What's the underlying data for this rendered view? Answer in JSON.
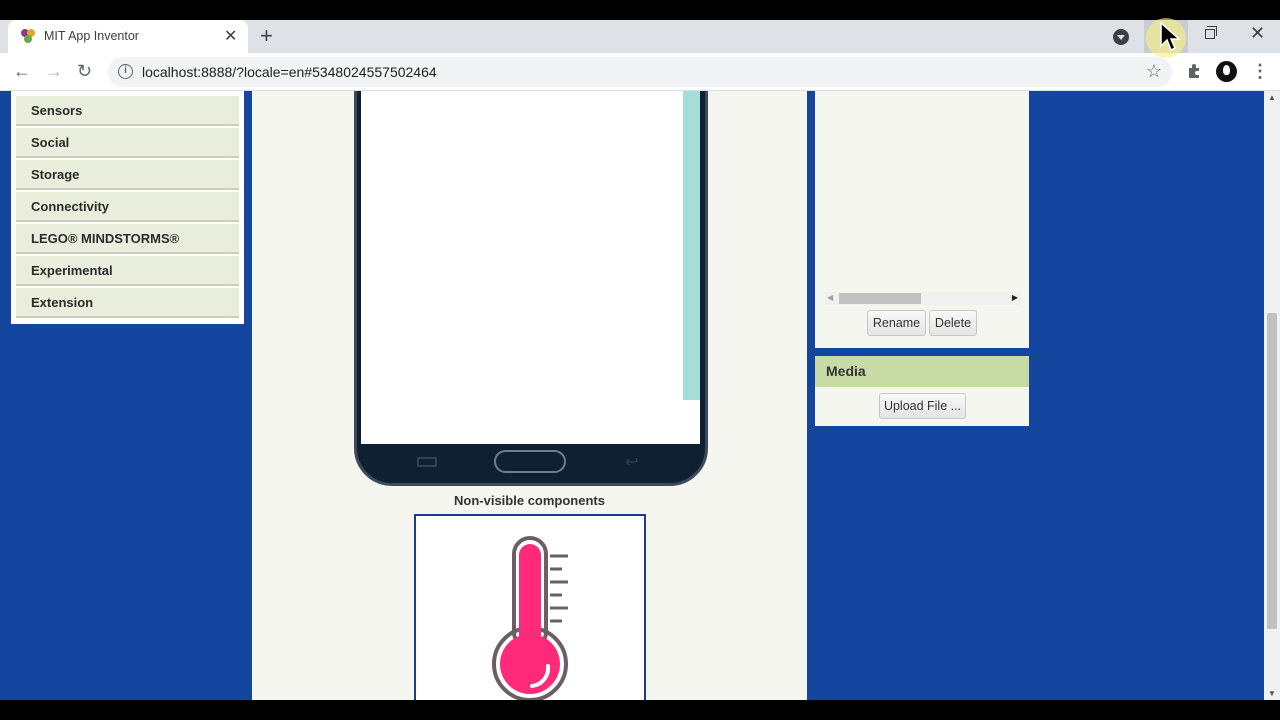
{
  "browser": {
    "tab_title": "MIT App Inventor",
    "tab_close": "✕",
    "new_tab": "+",
    "url": "localhost:8888/?locale=en#5348024557502464",
    "win_close": "✕",
    "back_icon": "←",
    "forward_icon": "→",
    "reload_icon": "↻",
    "star_icon": "☆",
    "menu_icon": "⋮"
  },
  "palette": {
    "items": [
      "Sensors",
      "Social",
      "Storage",
      "Connectivity",
      "LEGO® MINDSTORMS®",
      "Experimental",
      "Extension"
    ]
  },
  "viewer": {
    "nonvisible_label": "Non-visible components",
    "component_icon": "thermometer-icon"
  },
  "properties": {
    "rename_label": "Rename",
    "delete_label": "Delete"
  },
  "media": {
    "title": "Media",
    "upload_label": "Upload File ..."
  },
  "colors": {
    "page_bg": "#1446a0",
    "palette_item_bg": "#e9eedc",
    "media_header_bg": "#c9dba5",
    "thermometer": "#ff2a7a"
  }
}
